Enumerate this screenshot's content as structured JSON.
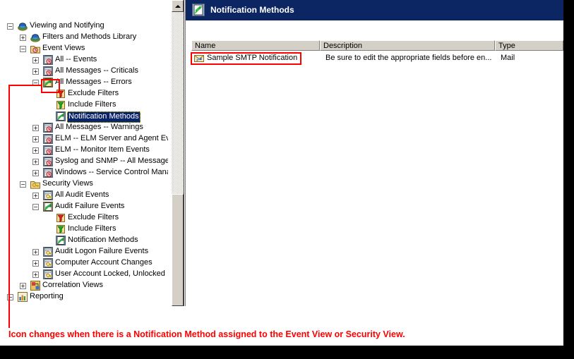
{
  "window": {
    "title": "Notification Methods",
    "title_icon": "notification-method-icon"
  },
  "tree": {
    "nodes": [
      {
        "label": "Viewing and Notifying",
        "depth": 0,
        "expander": "minus",
        "icon": "globe-icon",
        "selected": false
      },
      {
        "label": "Filters and Methods Library",
        "depth": 1,
        "expander": "plus",
        "icon": "globe-icon",
        "selected": false
      },
      {
        "label": "Event Views",
        "depth": 1,
        "expander": "minus",
        "icon": "folder-clock-icon",
        "selected": false
      },
      {
        "label": "All -- Events",
        "depth": 2,
        "expander": "plus",
        "icon": "event-view-icon",
        "selected": false
      },
      {
        "label": "All Messages -- Criticals",
        "depth": 2,
        "expander": "plus",
        "icon": "event-view-icon",
        "selected": false
      },
      {
        "label": "All Messages -- Errors",
        "depth": 2,
        "expander": "minus",
        "icon": "event-view-notified-icon",
        "selected": false
      },
      {
        "label": "Exclude Filters",
        "depth": 3,
        "expander": "none",
        "icon": "exclude-filter-icon",
        "selected": false
      },
      {
        "label": "Include Filters",
        "depth": 3,
        "expander": "none",
        "icon": "include-filter-icon",
        "selected": false
      },
      {
        "label": "Notification Methods",
        "depth": 3,
        "expander": "none",
        "icon": "notification-method-icon",
        "selected": true
      },
      {
        "label": "All Messages -- Warnings",
        "depth": 2,
        "expander": "plus",
        "icon": "event-view-icon",
        "selected": false
      },
      {
        "label": "ELM -- ELM Server and Agent Even",
        "depth": 2,
        "expander": "plus",
        "icon": "event-view-icon",
        "selected": false
      },
      {
        "label": "ELM -- Monitor Item Events",
        "depth": 2,
        "expander": "plus",
        "icon": "event-view-icon",
        "selected": false
      },
      {
        "label": "Syslog and SNMP -- All Messages",
        "depth": 2,
        "expander": "plus",
        "icon": "event-view-icon",
        "selected": false
      },
      {
        "label": "Windows -- Service Control Manag",
        "depth": 2,
        "expander": "plus",
        "icon": "event-view-icon",
        "selected": false
      },
      {
        "label": "Security Views",
        "depth": 1,
        "expander": "minus",
        "icon": "folder-key-icon",
        "selected": false
      },
      {
        "label": "All Audit Events",
        "depth": 2,
        "expander": "plus",
        "icon": "security-view-icon",
        "selected": false
      },
      {
        "label": "Audit Failure Events",
        "depth": 2,
        "expander": "minus",
        "icon": "security-view-notified-icon",
        "selected": false
      },
      {
        "label": "Exclude Filters",
        "depth": 3,
        "expander": "none",
        "icon": "exclude-filter-icon",
        "selected": false
      },
      {
        "label": "Include Filters",
        "depth": 3,
        "expander": "none",
        "icon": "include-filter-icon",
        "selected": false
      },
      {
        "label": "Notification Methods",
        "depth": 3,
        "expander": "none",
        "icon": "notification-method-icon",
        "selected": false
      },
      {
        "label": "Audit Logon Failure Events",
        "depth": 2,
        "expander": "plus",
        "icon": "security-view-icon",
        "selected": false
      },
      {
        "label": "Computer Account Changes",
        "depth": 2,
        "expander": "plus",
        "icon": "security-view-icon",
        "selected": false
      },
      {
        "label": "User Account Locked, Unlocked",
        "depth": 2,
        "expander": "plus",
        "icon": "security-view-icon",
        "selected": false
      },
      {
        "label": "Correlation Views",
        "depth": 1,
        "expander": "plus",
        "icon": "correlation-view-icon",
        "selected": false
      },
      {
        "label": "Reporting",
        "depth": 0,
        "expander": "minus",
        "icon": "reporting-icon",
        "selected": false
      }
    ]
  },
  "list": {
    "columns": [
      "Name",
      "Description",
      "Type"
    ],
    "rows": [
      {
        "name": "Sample SMTP Notification",
        "description": "Be sure to edit the appropriate fields before en...",
        "type": "Mail",
        "icon": "mail-notification-icon",
        "highlighted": true
      }
    ]
  },
  "scrollbar": {
    "up_arrow": "scroll-up-arrow"
  },
  "annotation": {
    "caption": "Icon changes when there is a Notification Method assigned to the Event View or Security View.",
    "color": "#ff0000"
  }
}
